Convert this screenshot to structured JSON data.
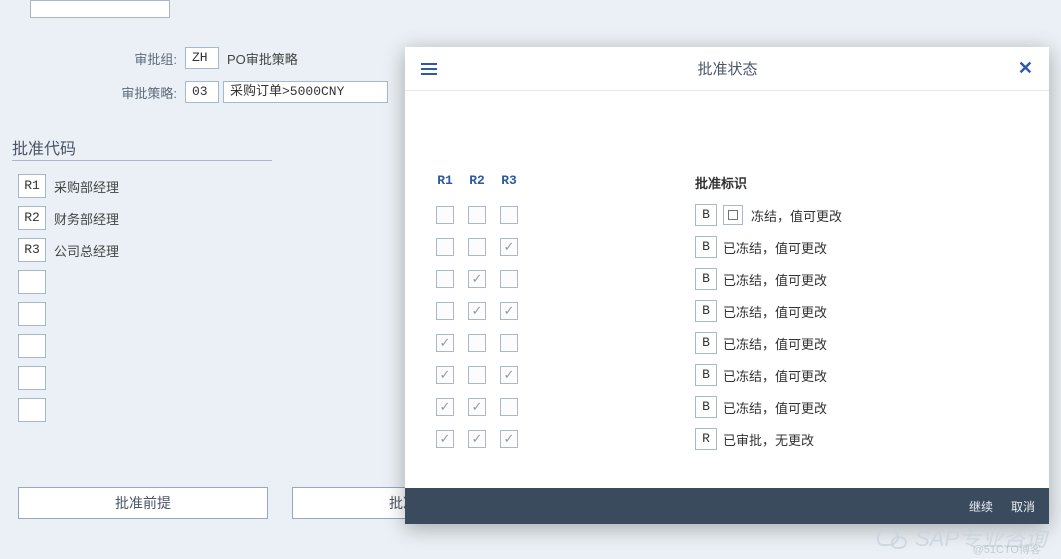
{
  "form": {
    "group_label": "审批组:",
    "group_code": "ZH",
    "group_text": "PO审批策略",
    "strategy_label": "审批策略:",
    "strategy_code": "03",
    "strategy_text": "采购订单>5000CNY"
  },
  "section": {
    "title": "批准代码"
  },
  "codes": [
    {
      "code": "R1",
      "label": "采购部经理"
    },
    {
      "code": "R2",
      "label": "财务部经理"
    },
    {
      "code": "R3",
      "label": "公司总经理"
    },
    {
      "code": "",
      "label": ""
    },
    {
      "code": "",
      "label": ""
    },
    {
      "code": "",
      "label": ""
    },
    {
      "code": "",
      "label": ""
    },
    {
      "code": "",
      "label": ""
    }
  ],
  "buttons": {
    "prereq": "批准前提",
    "status": "批准状态"
  },
  "dialog": {
    "title": "批准状态",
    "col_headers": [
      "R1",
      "R2",
      "R3"
    ],
    "flag_header": "批准标识",
    "rows": [
      {
        "checks": [
          false,
          false,
          false
        ],
        "flag": "B",
        "lookup": true,
        "desc": "冻结，值可更改"
      },
      {
        "checks": [
          false,
          false,
          true
        ],
        "flag": "B",
        "lookup": false,
        "desc": "已冻结，值可更改"
      },
      {
        "checks": [
          false,
          true,
          false
        ],
        "flag": "B",
        "lookup": false,
        "desc": "已冻结，值可更改"
      },
      {
        "checks": [
          false,
          true,
          true
        ],
        "flag": "B",
        "lookup": false,
        "desc": "已冻结，值可更改"
      },
      {
        "checks": [
          true,
          false,
          false
        ],
        "flag": "B",
        "lookup": false,
        "desc": "已冻结，值可更改"
      },
      {
        "checks": [
          true,
          false,
          true
        ],
        "flag": "B",
        "lookup": false,
        "desc": "已冻结，值可更改"
      },
      {
        "checks": [
          true,
          true,
          false
        ],
        "flag": "B",
        "lookup": false,
        "desc": "已冻结，值可更改"
      },
      {
        "checks": [
          true,
          true,
          true
        ],
        "flag": "R",
        "lookup": false,
        "desc": "已审批，无更改"
      }
    ],
    "footer": {
      "continue": "继续",
      "cancel": "取消"
    }
  },
  "watermark": {
    "text": "SAP专业咨询",
    "sub": "@51CTO博客"
  }
}
